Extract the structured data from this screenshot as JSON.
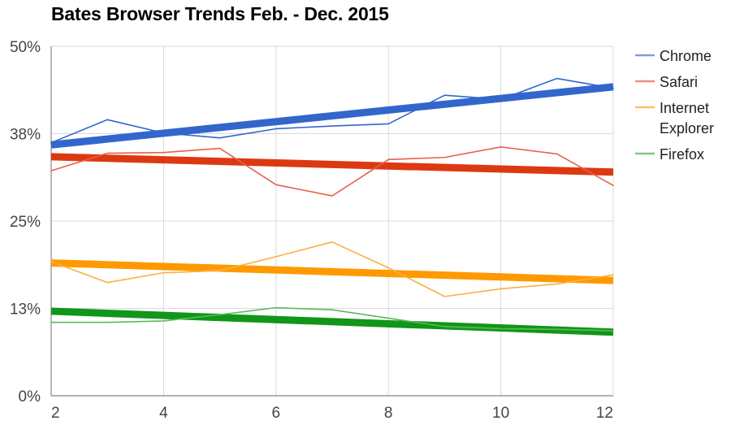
{
  "chart_data": {
    "type": "line",
    "title": "Bates Browser Trends Feb. - Dec. 2015",
    "xlabel": "",
    "ylabel": "",
    "xlim": [
      2,
      12
    ],
    "ylim": [
      0,
      50
    ],
    "grid": true,
    "legend_position": "right",
    "x": [
      2,
      3,
      4,
      5,
      6,
      7,
      8,
      9,
      10,
      11,
      12
    ],
    "y_tick_labels": [
      "0%",
      "13%",
      "25%",
      "38%",
      "50%"
    ],
    "y_tick_values": [
      0,
      12.5,
      25,
      37.5,
      50
    ],
    "x_tick_labels": [
      "2",
      "4",
      "6",
      "8",
      "10",
      "12"
    ],
    "x_tick_values": [
      2,
      4,
      6,
      8,
      10,
      12
    ],
    "series": [
      {
        "name": "Chrome",
        "color": "#3366cc",
        "trend_color": "#3366cc",
        "values": [
          36.2,
          39.5,
          37.6,
          36.9,
          38.2,
          38.6,
          38.9,
          43.0,
          42.4,
          45.4,
          44.0
        ],
        "trend": [
          35.9,
          44.2
        ]
      },
      {
        "name": "Safari",
        "color": "#e8604c",
        "trend_color": "#dc3912",
        "values": [
          32.2,
          34.7,
          34.8,
          35.4,
          30.2,
          28.6,
          33.8,
          34.1,
          35.6,
          34.6,
          30.1
        ],
        "trend": [
          34.2,
          32.0
        ]
      },
      {
        "name": "Internet Explorer",
        "color": "#fcb040",
        "trend_color": "#ff9900",
        "values": [
          19.2,
          16.2,
          17.6,
          17.9,
          19.9,
          22.0,
          18.3,
          14.2,
          15.3,
          16.0,
          17.3
        ],
        "trend": [
          19.0,
          16.5
        ]
      },
      {
        "name": "Firefox",
        "color": "#5cb85c",
        "trend_color": "#109618",
        "values": [
          10.5,
          10.5,
          10.7,
          11.6,
          12.6,
          12.3,
          11.1,
          9.9,
          9.6,
          9.5,
          9.3
        ],
        "trend": [
          12.1,
          9.1
        ]
      }
    ],
    "legend_entries": [
      {
        "label": "Chrome",
        "color": "#7f9ee0"
      },
      {
        "label": "Safari",
        "color": "#ef8f7f"
      },
      {
        "label": "Internet Explorer",
        "color": "#fcc164"
      },
      {
        "label": "Firefox",
        "color": "#7cc97c"
      }
    ]
  }
}
